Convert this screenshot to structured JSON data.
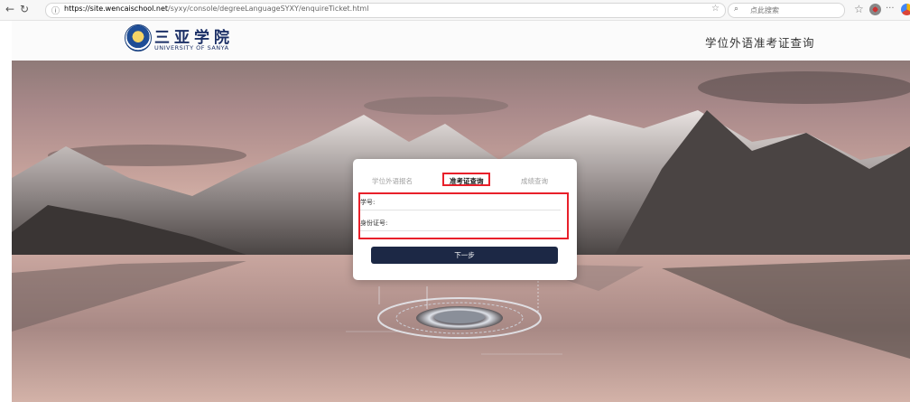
{
  "browser": {
    "url_host": "https://site.wencaischool.net",
    "url_path": "/syxy/console/degreeLanguageSYXY/enquireTicket.html",
    "search_placeholder": "点此搜索"
  },
  "header": {
    "logo_cn": "三亚学院",
    "logo_en": "UNIVERSITY OF SANYA",
    "title": "学位外语准考证查询"
  },
  "card": {
    "tabs": [
      {
        "label": "学位外语报名",
        "active": false
      },
      {
        "label": "准考证查询",
        "active": true
      },
      {
        "label": "成绩查询",
        "active": false
      }
    ],
    "fields": [
      {
        "label": "学号:",
        "value": "",
        "placeholder": ""
      },
      {
        "label": "身份证号:",
        "value": "",
        "placeholder": ""
      }
    ],
    "next_button": "下一步"
  },
  "colors": {
    "highlight": "#e8202a",
    "button_bg": "#1c2845",
    "brand": "#1b2f66"
  },
  "icons": [
    "back-arrow-icon",
    "refresh-icon",
    "lock-icon",
    "favorite-star-icon",
    "search-icon",
    "collection-star-icon",
    "extension-icon",
    "more-icon",
    "browser-logo-icon"
  ]
}
